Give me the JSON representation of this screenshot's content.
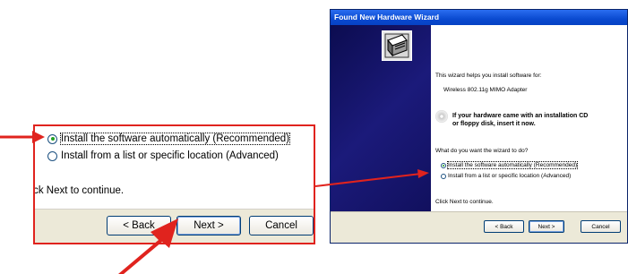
{
  "colors": {
    "callout_red": "#e0231e",
    "titlebar_blue": "#0a4ad0",
    "dialog_bg": "#ece9d8",
    "radio_green": "#21a121"
  },
  "callout": {
    "option_auto": "Install the software automatically (Recommended)",
    "option_list": "Install from a list or specific location (Advanced)",
    "continue_text": "lick Next to continue.",
    "back_button": "< Back",
    "next_button": "Next >",
    "cancel_button": "Cancel"
  },
  "wizard": {
    "title": "Found New Hardware Wizard",
    "intro": "This wizard helps you install software for:",
    "device": "Wireless 802.11g MIMO Adapter",
    "cd_prompt_line1": "If your hardware came with an installation CD",
    "cd_prompt_line2": "or floppy disk, insert it now.",
    "question": "What do you want the wizard to do?",
    "option_auto": "Install the software automatically (Recommended)",
    "option_list": "Install from a list or specific location (Advanced)",
    "continue_text": "Click Next to continue.",
    "back_button": "< Back",
    "next_button": "Next >",
    "cancel_button": "Cancel",
    "selected_option": "auto"
  },
  "icons": [
    "hardware-wizard-icon",
    "cd-icon",
    "arrow-icon"
  ]
}
